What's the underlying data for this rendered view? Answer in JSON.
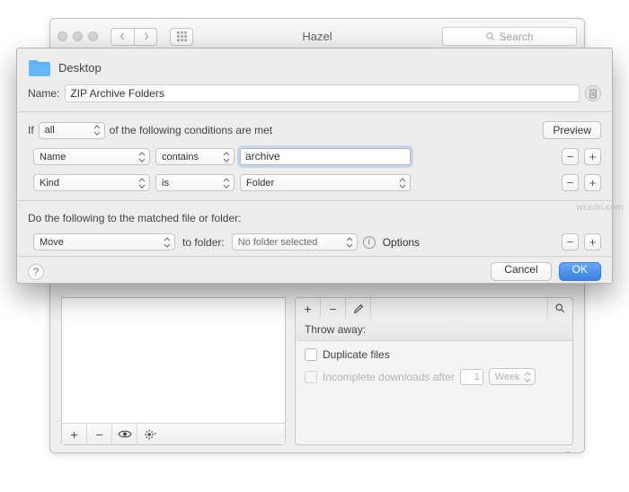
{
  "parent": {
    "title": "Hazel",
    "search_placeholder": "Search"
  },
  "sheet": {
    "folder_label": "Desktop",
    "name_label": "Name:",
    "name_value": "ZIP Archive Folders",
    "if_prefix": "If",
    "all_label": "all",
    "if_suffix": "of the following conditions are met",
    "preview_label": "Preview",
    "conditions": [
      {
        "attr": "Name",
        "op": "contains",
        "value": "archive",
        "editing": true
      },
      {
        "attr": "Kind",
        "op": "is",
        "value": "Folder",
        "editing": false
      }
    ],
    "actions_label": "Do the following to the matched file or folder:",
    "action": {
      "verb": "Move",
      "to_label": "to folder:",
      "folder": "No folder selected",
      "options_label": "Options"
    },
    "cancel_label": "Cancel",
    "ok_label": "OK"
  },
  "throw": {
    "header": "Throw away:",
    "duplicate_label": "Duplicate files",
    "incomplete_label": "Incomplete downloads after",
    "incomplete_value": "1",
    "incomplete_unit": "Week"
  },
  "watermark": "wsxdn.com"
}
